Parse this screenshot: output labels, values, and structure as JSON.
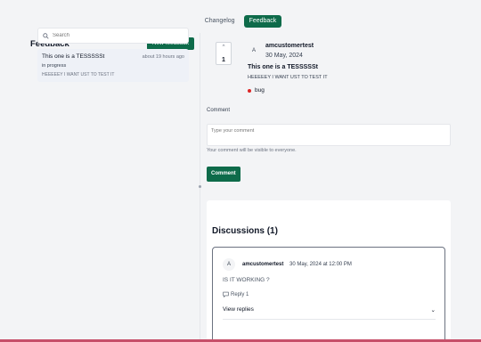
{
  "nav": {
    "tabs": [
      {
        "label": "Changelog"
      },
      {
        "label": "Feedback"
      }
    ]
  },
  "sidebar": {
    "title": "Feedback",
    "new_label": "New feedback",
    "search_placeholder": "Search",
    "items": [
      {
        "title": "This one is a TESSSSSt",
        "time": "about 19 hours ago",
        "status": "in progress",
        "description": "HEEEEEY I WANT UST TO TEST IT"
      }
    ]
  },
  "post": {
    "vote_count": "1",
    "author_initial": "A",
    "author": "amcustomertest",
    "date": "30 May, 2024",
    "title": "This one is a TESSSSSt",
    "body": "HEEEEEY I WANT UST TO TEST IT",
    "tag": "bug",
    "tag_color": "#dc2626"
  },
  "comment": {
    "label": "Comment",
    "placeholder": "Type your comment",
    "hint": "Your comment will be visible to everyone.",
    "button": "Comment"
  },
  "discussions": {
    "title": "Discussions (1)",
    "items": [
      {
        "initial": "A",
        "author": "amcustomertest",
        "date": "30 May, 2024 at 12:00 PM",
        "body": "IS IT WORKING ?",
        "reply": "Reply 1",
        "view_replies": "View replies"
      }
    ]
  },
  "colors": {
    "accent": "#0e6b4a",
    "bottom_bar": "#c7506a"
  }
}
